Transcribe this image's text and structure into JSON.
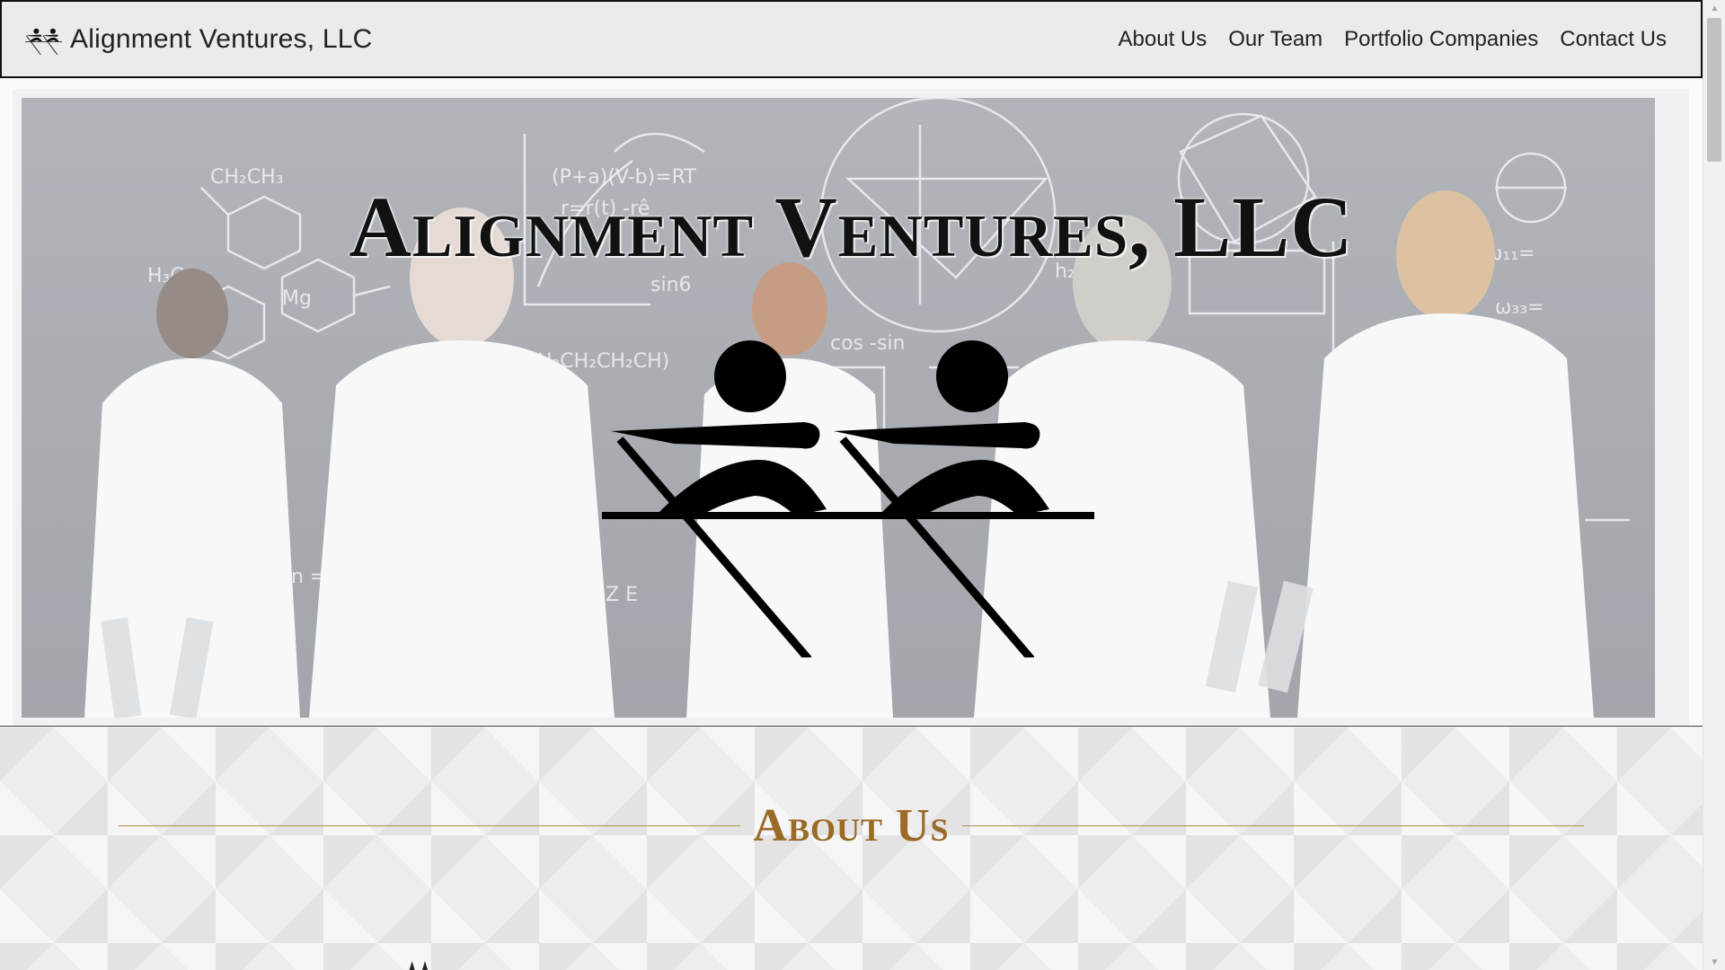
{
  "header": {
    "brand_name": "Alignment Ventures, LLC",
    "logo_icon": "rowers-logo-icon",
    "nav": [
      {
        "label": "About Us"
      },
      {
        "label": "Our Team"
      },
      {
        "label": "Portfolio Companies"
      },
      {
        "label": "Contact Us"
      }
    ]
  },
  "hero": {
    "title": "Alignment Ventures, LLC",
    "logo_icon": "rowers-logo-icon"
  },
  "about": {
    "title": "About Us"
  },
  "colors": {
    "accent": "#9a6a26",
    "nav_background": "#ebebeb",
    "text": "#222222"
  }
}
